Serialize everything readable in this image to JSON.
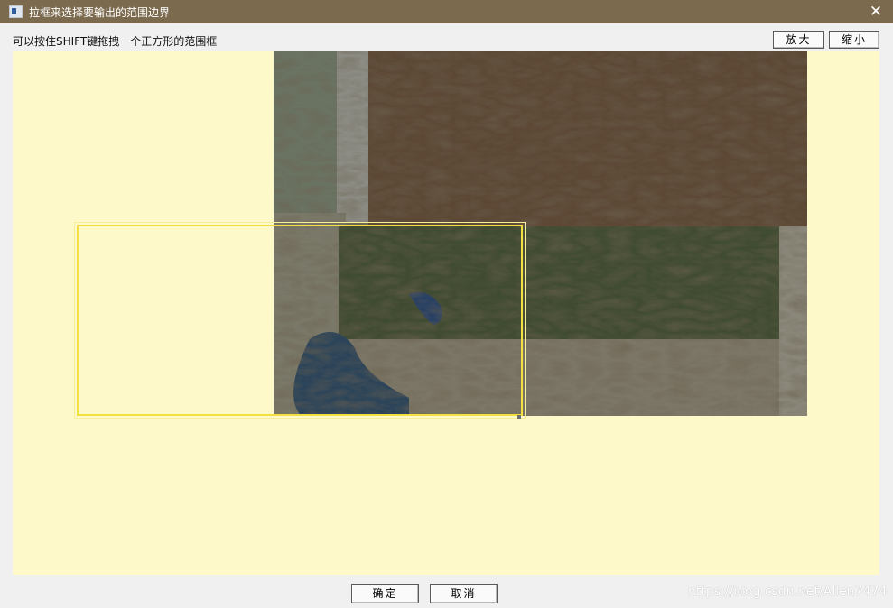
{
  "window": {
    "title": "拉框来选择要输出的范围边界",
    "close_glyph": "✕",
    "title_bar_color": "#7b6a4e",
    "icon": "window-app-icon"
  },
  "toolbar": {
    "hint": "可以按住SHIFT键拖拽一个正方形的范围框",
    "zoom_in_label": "放大",
    "zoom_out_label": "缩小"
  },
  "canvas": {
    "background_color": "#fdf9c8",
    "image": "satellite-map-image",
    "selection_box_color": "#f3df3f"
  },
  "footer": {
    "ok_label": "确定",
    "cancel_label": "取消"
  },
  "watermark": "https://blog.csdn.net/Allen7474"
}
